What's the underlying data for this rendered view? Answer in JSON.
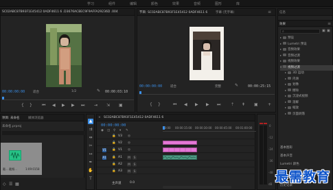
{
  "workspaces": [
    "学习",
    "组件",
    "编辑",
    "颜色",
    "效果",
    "音频",
    "图形",
    "库"
  ],
  "source_monitor": {
    "tab": "SC02ABC87B93F1E45412",
    "clip_path": "SC02ABC87B93F1E45412 0ADF4611 6 .D3676ACBEC9F9AFFA29236D .004",
    "timecode": "00:00:00:00",
    "fit": "适合",
    "fraction": "1/2",
    "duration": "00:00:03:10"
  },
  "program_monitor": {
    "tab": "节目: SC02ABC87B93F1E45412 0ADF4611 6",
    "other_tab": "字幕 (无字幕)",
    "timecode": "00:00:00:00",
    "fit": "适合",
    "quality": "完整",
    "duration": "00:00:25:15"
  },
  "project_panel": {
    "tab": "项目: 未命名",
    "browser_tab": "媒体浏览器",
    "file": "未命名.prproj",
    "clip_name": "截... 截频...",
    "clip_duration": "1:09:0158"
  },
  "timeline": {
    "tab": "SC02ABC87B93F1E45412 0ADF4611 6",
    "timecode": "00:00:00:00",
    "ruler_labels": [
      "00:00",
      "00:00:15:00",
      "00:00:30:00",
      "00:00:45:00",
      "00:01:00:00"
    ],
    "video_tracks": [
      "V3",
      "V2",
      "V1"
    ],
    "audio_tracks": [
      "A1",
      "A2",
      "A3"
    ],
    "source_patch": [
      "V1",
      "A1"
    ],
    "master_label": "主声道",
    "master_value": "0.0"
  },
  "meter_scale": [
    "0",
    "-12",
    "-24",
    "-36",
    "-48",
    "dB"
  ],
  "effects_panel": {
    "top_tabs": [
      "信息",
      "效果"
    ],
    "items": [
      {
        "label": "预设",
        "level": 0,
        "open": false
      },
      {
        "label": "Lumetri 预设",
        "level": 0,
        "open": false
      },
      {
        "label": "音频效果",
        "level": 0,
        "open": false
      },
      {
        "label": "音频过渡",
        "level": 0,
        "open": false
      },
      {
        "label": "视频效果",
        "level": 0,
        "open": false
      },
      {
        "label": "视频过渡",
        "level": 0,
        "open": true,
        "selected": true
      },
      {
        "label": "3D 运动",
        "level": 1,
        "open": false
      },
      {
        "label": "内滑",
        "level": 1,
        "open": false
      },
      {
        "label": "划像",
        "level": 1,
        "open": false
      },
      {
        "label": "擦除",
        "level": 1,
        "open": false
      },
      {
        "label": "沉浸式视频",
        "level": 1,
        "open": false
      },
      {
        "label": "溶解",
        "level": 1,
        "open": false
      },
      {
        "label": "缩放",
        "level": 1,
        "open": false
      },
      {
        "label": "页面剥落",
        "level": 1,
        "open": false
      }
    ],
    "bottom_labels": [
      "基本图形",
      "基本声音",
      "Lumetri 颜色",
      "库",
      "标记",
      "历史记录"
    ]
  },
  "watermark": "最需教育",
  "colors": {
    "accent": "#3b8ee6",
    "video_clip": "#e477d6",
    "audio_clip": "#4f9a84",
    "adjustment_clip": "#b7b8e8",
    "watermark": "#0d53c9"
  }
}
